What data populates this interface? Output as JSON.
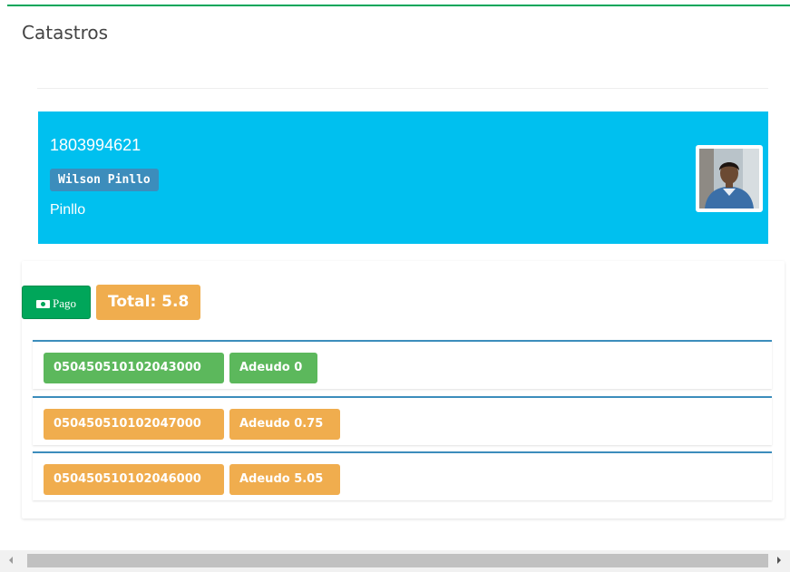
{
  "header": {
    "title": "Catastros"
  },
  "person": {
    "cedula": "1803994621",
    "full_name": "Wilson Pinllo",
    "surname": "Pinllo"
  },
  "payment": {
    "pay_button_label": "Pago",
    "total_label": "Total: 5.8"
  },
  "catastros": [
    {
      "code": "050450510102043000",
      "debt": "Adeudo 0",
      "status": "paid"
    },
    {
      "code": "050450510102047000",
      "debt": "Adeudo 0.75",
      "status": "due"
    },
    {
      "code": "050450510102046000",
      "debt": "Adeudo 5.05",
      "status": "due"
    }
  ],
  "colors": {
    "box_top_border": "#00a65a",
    "info_card_bg": "#00c0ef",
    "name_label_bg": "#3c8dbc",
    "pay_button_bg": "#00a65a",
    "warning": "#f0ad4e",
    "success": "#5cb85c",
    "row_border": "#3c8dbc"
  },
  "icons": {
    "pay_button_icon": "money-icon"
  }
}
